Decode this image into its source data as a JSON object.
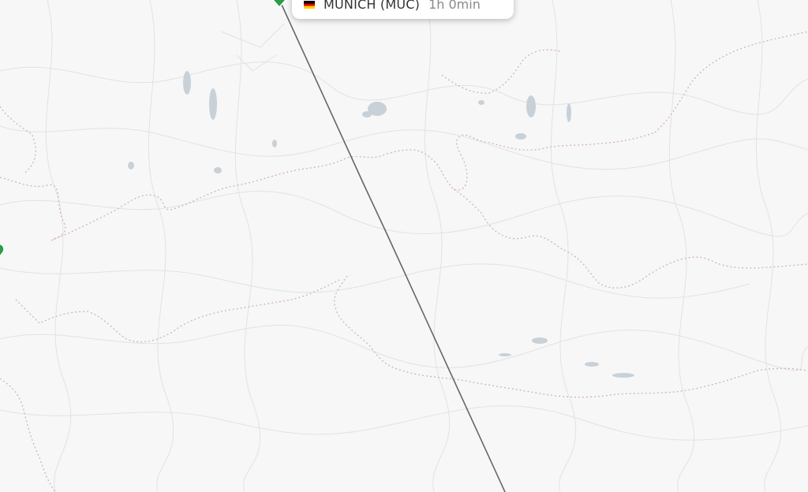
{
  "popup": {
    "airport": "MUNICH (MUC)",
    "duration": "1h 0min",
    "flag_icon": "germany-flag-icon"
  },
  "map": {
    "background": "#f7f7f7",
    "route_color": "#666666",
    "marker_color": "#2a9d4a",
    "border_color": "#d4b2b6",
    "water_color": "#c9d1d8"
  }
}
